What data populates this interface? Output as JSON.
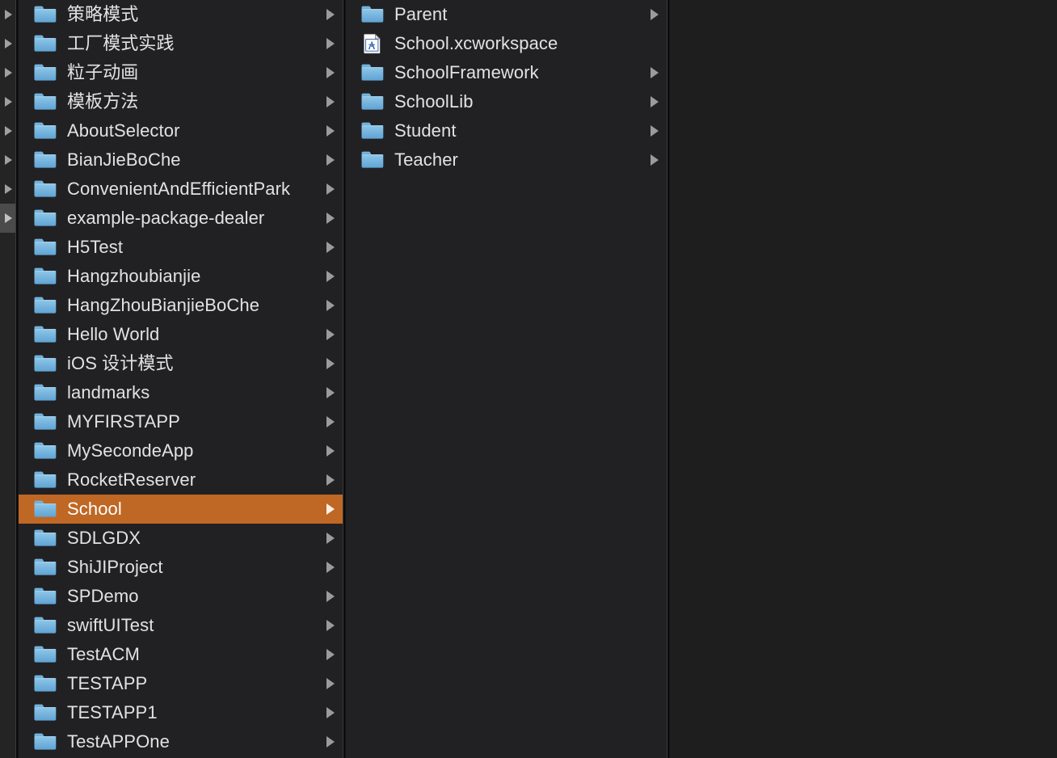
{
  "window": {
    "view_mode": "column-view",
    "background_color": "#1e1e1f",
    "selection_color": "#bf6724",
    "inactive_selection_color": "#4b4b4c",
    "folder_icon_color": "#6aaede"
  },
  "sliver_column": {
    "name": "parent-folder-column-partial",
    "rows": [
      {
        "arrow": true,
        "selected": false
      },
      {
        "arrow": true,
        "selected": false
      },
      {
        "arrow": true,
        "selected": false
      },
      {
        "arrow": true,
        "selected": false
      },
      {
        "arrow": true,
        "selected": false
      },
      {
        "arrow": true,
        "selected": false
      },
      {
        "arrow": true,
        "selected": false
      },
      {
        "arrow": true,
        "selected": true
      },
      {
        "arrow": false,
        "selected": false
      },
      {
        "arrow": false,
        "selected": false
      },
      {
        "arrow": false,
        "selected": false
      },
      {
        "arrow": false,
        "selected": false
      },
      {
        "arrow": false,
        "selected": false
      },
      {
        "arrow": false,
        "selected": false
      },
      {
        "arrow": false,
        "selected": false
      },
      {
        "arrow": false,
        "selected": false
      },
      {
        "arrow": false,
        "selected": false
      },
      {
        "arrow": false,
        "selected": false
      },
      {
        "arrow": false,
        "selected": false
      },
      {
        "arrow": false,
        "selected": false
      },
      {
        "arrow": false,
        "selected": false
      },
      {
        "arrow": false,
        "selected": false
      },
      {
        "arrow": false,
        "selected": false
      },
      {
        "arrow": false,
        "selected": false
      },
      {
        "arrow": false,
        "selected": false
      },
      {
        "arrow": false,
        "selected": false
      }
    ]
  },
  "projects_column": {
    "name": "projects-column",
    "items": [
      {
        "label": "策略模式",
        "icon": "folder-icon",
        "arrow": true,
        "selected": false
      },
      {
        "label": "工厂模式实践",
        "icon": "folder-icon",
        "arrow": true,
        "selected": false
      },
      {
        "label": "粒子动画",
        "icon": "folder-icon",
        "arrow": true,
        "selected": false
      },
      {
        "label": "模板方法",
        "icon": "folder-icon",
        "arrow": true,
        "selected": false
      },
      {
        "label": "AboutSelector",
        "icon": "folder-icon",
        "arrow": true,
        "selected": false
      },
      {
        "label": "BianJieBoChe",
        "icon": "folder-icon",
        "arrow": true,
        "selected": false
      },
      {
        "label": "ConvenientAndEfficientPark",
        "icon": "folder-icon",
        "arrow": true,
        "selected": false
      },
      {
        "label": "example-package-dealer",
        "icon": "folder-icon",
        "arrow": true,
        "selected": false
      },
      {
        "label": "H5Test",
        "icon": "folder-icon",
        "arrow": true,
        "selected": false
      },
      {
        "label": "Hangzhoubianjie",
        "icon": "folder-icon",
        "arrow": true,
        "selected": false
      },
      {
        "label": "HangZhouBianjieBoChe",
        "icon": "folder-icon",
        "arrow": true,
        "selected": false
      },
      {
        "label": "Hello World",
        "icon": "folder-icon",
        "arrow": true,
        "selected": false
      },
      {
        "label": "iOS 设计模式",
        "icon": "folder-icon",
        "arrow": true,
        "selected": false
      },
      {
        "label": "landmarks",
        "icon": "folder-icon",
        "arrow": true,
        "selected": false
      },
      {
        "label": "MYFIRSTAPP",
        "icon": "folder-icon",
        "arrow": true,
        "selected": false
      },
      {
        "label": "MySecondeApp",
        "icon": "folder-icon",
        "arrow": true,
        "selected": false
      },
      {
        "label": "RocketReserver",
        "icon": "folder-icon",
        "arrow": true,
        "selected": false
      },
      {
        "label": "School",
        "icon": "folder-icon",
        "arrow": true,
        "selected": true
      },
      {
        "label": "SDLGDX",
        "icon": "folder-icon",
        "arrow": true,
        "selected": false
      },
      {
        "label": "ShiJIProject",
        "icon": "folder-icon",
        "arrow": true,
        "selected": false
      },
      {
        "label": "SPDemo",
        "icon": "folder-icon",
        "arrow": true,
        "selected": false
      },
      {
        "label": "swiftUITest",
        "icon": "folder-icon",
        "arrow": true,
        "selected": false
      },
      {
        "label": "TestACM",
        "icon": "folder-icon",
        "arrow": true,
        "selected": false
      },
      {
        "label": "TESTAPP",
        "icon": "folder-icon",
        "arrow": true,
        "selected": false
      },
      {
        "label": "TESTAPP1",
        "icon": "folder-icon",
        "arrow": true,
        "selected": false
      },
      {
        "label": "TestAPPOne",
        "icon": "folder-icon",
        "arrow": true,
        "selected": false
      }
    ]
  },
  "school_column": {
    "name": "school-folder-column",
    "items": [
      {
        "label": "Parent",
        "icon": "folder-icon",
        "arrow": true,
        "selected": false
      },
      {
        "label": "School.xcworkspace",
        "icon": "xcworkspace-icon",
        "arrow": false,
        "selected": false
      },
      {
        "label": "SchoolFramework",
        "icon": "folder-icon",
        "arrow": true,
        "selected": false
      },
      {
        "label": "SchoolLib",
        "icon": "folder-icon",
        "arrow": true,
        "selected": false
      },
      {
        "label": "Student",
        "icon": "folder-icon",
        "arrow": true,
        "selected": false
      },
      {
        "label": "Teacher",
        "icon": "folder-icon",
        "arrow": true,
        "selected": false
      }
    ]
  },
  "preview_column": {
    "name": "preview-column",
    "items": []
  }
}
